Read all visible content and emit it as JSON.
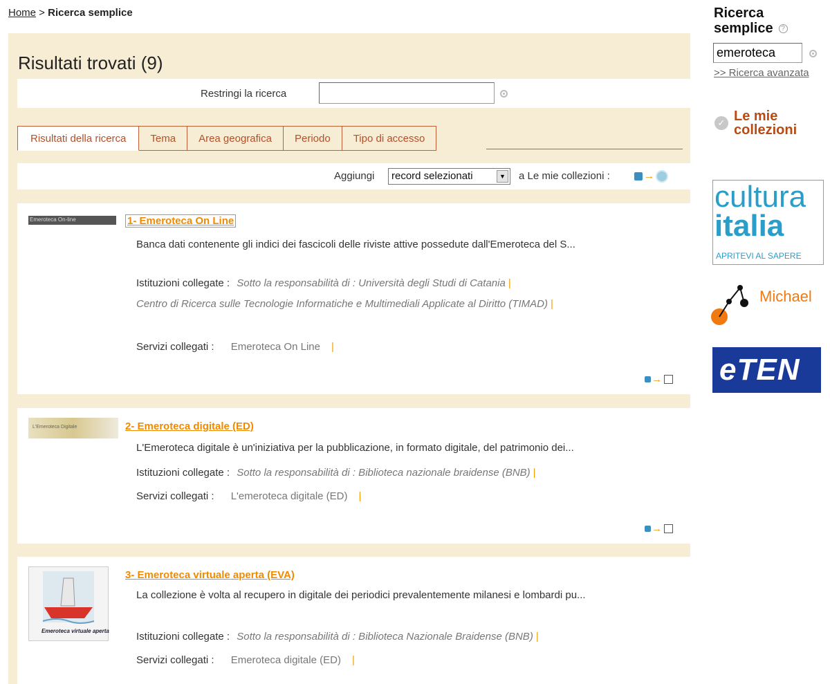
{
  "breadcrumb": {
    "home": "Home",
    "separator": " > ",
    "current": "Ricerca semplice"
  },
  "results": {
    "title": "Risultati trovati (9)",
    "refine_label": "Restringi la ricerca",
    "refine_value": "",
    "tabs": [
      {
        "label": "Risultati della ricerca",
        "active": true
      },
      {
        "label": "Tema",
        "active": false
      },
      {
        "label": "Area geografica",
        "active": false
      },
      {
        "label": "Periodo",
        "active": false
      },
      {
        "label": "Tipo di accesso",
        "active": false
      }
    ],
    "add_label": "Aggiungi",
    "add_select_value": "record selezionati",
    "add_suffix": "a Le mie collezioni :",
    "items": [
      {
        "title": "1- Emeroteca On Line",
        "thumb_text": "Emeroteca On-line",
        "description": "Banca dati contenente gli indici dei fascicoli delle riviste attive possedute dall'Emeroteca del S...",
        "institutions_label": "Istituzioni collegate :",
        "institution_1": "Sotto la responsabilità di : Università degli Studi di Catania",
        "institution_2": "Centro di Ricerca sulle Tecnologie Informatiche e Multimediali Applicate al Diritto (TIMAD)",
        "services_label": "Servizi collegati :",
        "service": "Emeroteca On Line"
      },
      {
        "title": "2- Emeroteca digitale (ED)",
        "thumb_text": "L'Emeroteca Digitale",
        "description": "L'Emeroteca digitale è un'iniziativa per la pubblicazione, in formato digitale, del patrimonio dei...",
        "institutions_label": "Istituzioni collegate :",
        "institution_1": "Sotto la responsabilità di : Biblioteca nazionale braidense (BNB)",
        "services_label": "Servizi collegati :",
        "service": "L'emeroteca digitale (ED)"
      },
      {
        "title": "3- Emeroteca virtuale aperta (EVA)",
        "thumb_text": "Emeroteca virtuale aperta",
        "description": "La collezione è volta al recupero in digitale dei periodici prevalentemente milanesi e lombardi pu...",
        "institutions_label": "Istituzioni collegate :",
        "institution_1": "Sotto la responsabilità di : Biblioteca Nazionale Braidense (BNB)",
        "services_label": "Servizi collegati :",
        "service": "Emeroteca digitale (ED)"
      }
    ]
  },
  "sidebar": {
    "title_line1": "Ricerca",
    "title_line2": "semplice",
    "search_value": "emeroteca",
    "advanced_link": ">> Ricerca avanzata",
    "collections_line1": "Le mie",
    "collections_line2": "collezioni",
    "logo_cultura_1": "cultura",
    "logo_cultura_2": "italia",
    "logo_cultura_3": "APRITEVI AL SAPERE",
    "logo_michael": "Michael",
    "logo_eten": "eTEN"
  },
  "colors": {
    "panel": "#f7ecd4",
    "accent": "#f08a00",
    "tab": "#b2502a",
    "collections": "#b84a14"
  }
}
